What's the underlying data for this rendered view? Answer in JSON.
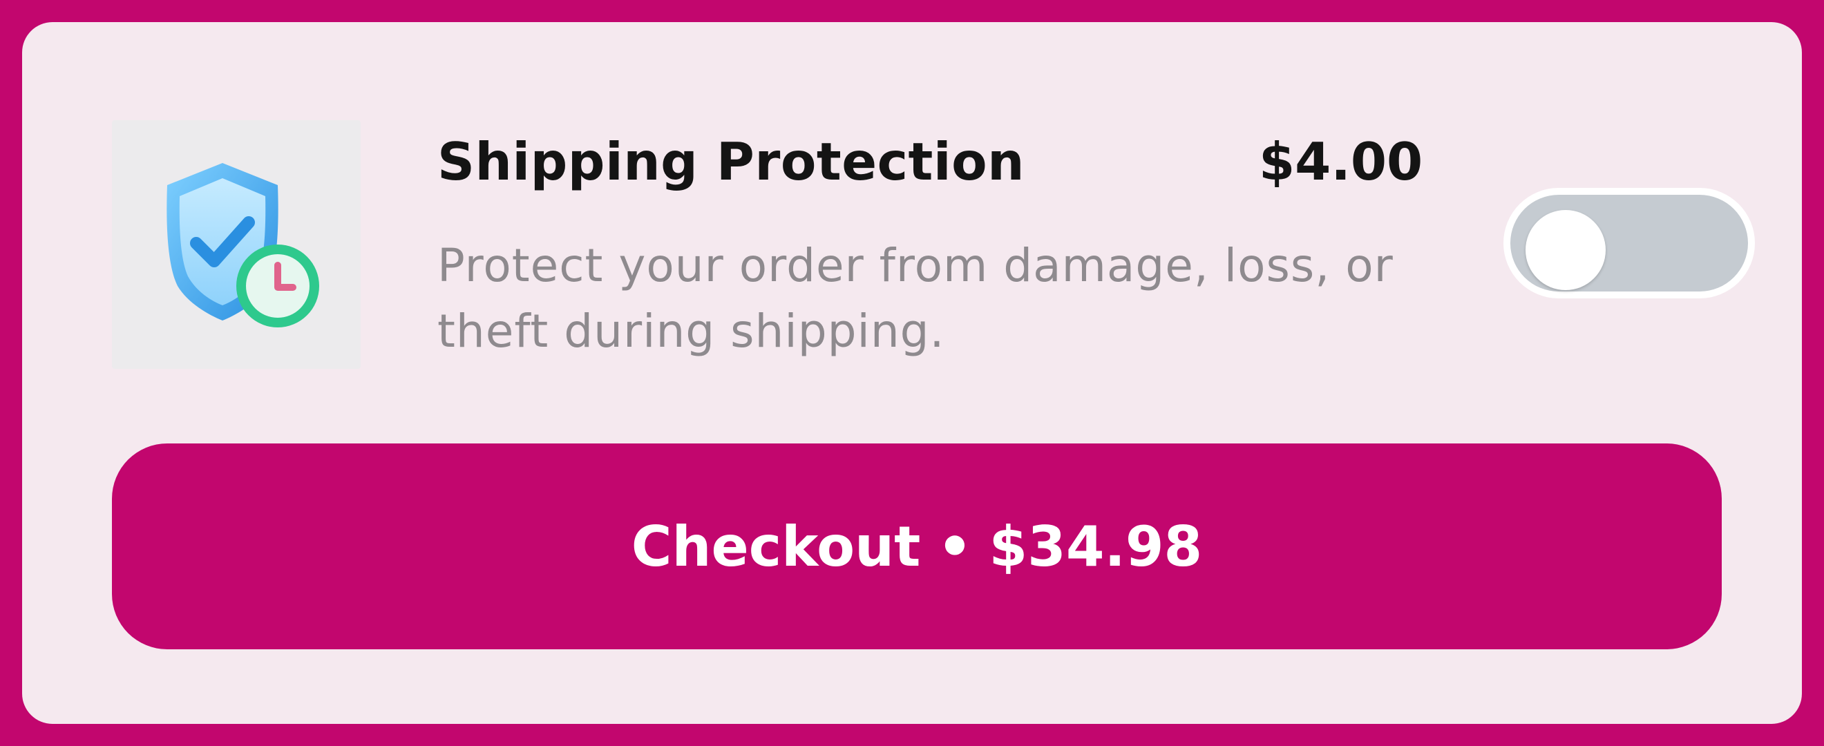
{
  "protection": {
    "title": "Shipping Protection",
    "price": "$4.00",
    "description": "Protect your order from damage, loss, or theft during shipping.",
    "enabled": false,
    "icon": "shield-check-clock-icon"
  },
  "checkout": {
    "label": "Checkout",
    "separator": "•",
    "total": "$34.98"
  },
  "colors": {
    "brand": "#c2066e",
    "card_background": "#f5e9ef",
    "toggle_off_track": "#c5cbd1",
    "shield_blue": "#3aa7ec",
    "clock_green": "#2ec98d"
  }
}
